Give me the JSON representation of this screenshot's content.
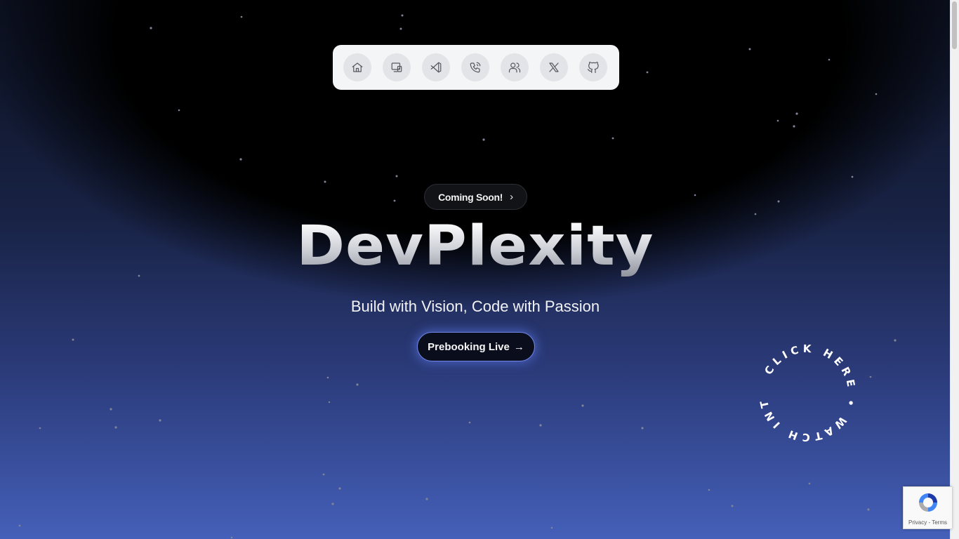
{
  "nav": {
    "items": [
      {
        "name": "home-icon",
        "label": "Home"
      },
      {
        "name": "devices-icon",
        "label": "Devices"
      },
      {
        "name": "vscode-icon",
        "label": "VS Code"
      },
      {
        "name": "phone-call-icon",
        "label": "Contact"
      },
      {
        "name": "users-icon",
        "label": "Team"
      },
      {
        "name": "x-icon",
        "label": "X"
      },
      {
        "name": "github-icon",
        "label": "GitHub"
      }
    ]
  },
  "hero": {
    "badge_label": "Coming Soon!",
    "title": "DevPlexity",
    "subtitle": "Build with Vision, Code with Passion",
    "cta_label": "Prebooking Live",
    "circle_text": "CLICK HERE • WATCH INTRO •"
  },
  "recaptcha": {
    "privacy": "Privacy",
    "terms": "Terms"
  },
  "colors": {
    "background": "#000000",
    "glow": "#4560b9",
    "accent": "#6f86e6",
    "dock": "#f4f5f7"
  }
}
